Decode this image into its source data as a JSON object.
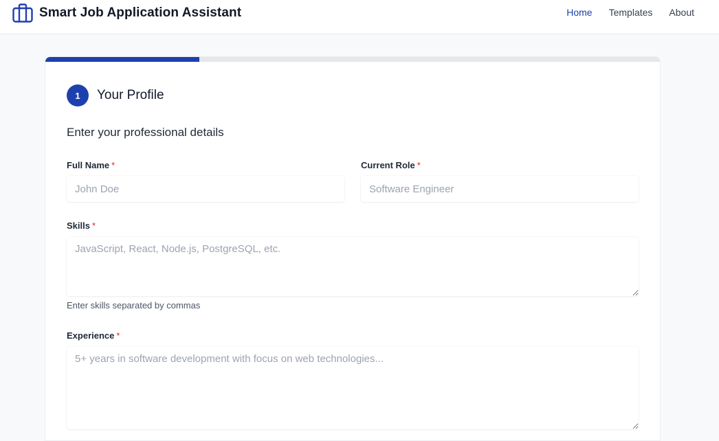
{
  "app": {
    "title": "Smart Job Application Assistant",
    "icon": "briefcase-icon",
    "accent": "#1e40af"
  },
  "nav": {
    "items": [
      {
        "label": "Home",
        "active": true
      },
      {
        "label": "Templates",
        "active": false
      },
      {
        "label": "About",
        "active": false
      }
    ]
  },
  "wizard": {
    "progress_fraction": 0.25,
    "step_number": "1",
    "step_title": "Your Profile",
    "section_title": "Enter your professional details"
  },
  "form": {
    "required_marker": "*",
    "full_name": {
      "label": "Full Name",
      "placeholder": "John Doe",
      "value": ""
    },
    "current_role": {
      "label": "Current Role",
      "placeholder": "Software Engineer",
      "value": ""
    },
    "skills": {
      "label": "Skills",
      "placeholder": "JavaScript, React, Node.js, PostgreSQL, etc.",
      "hint": "Enter skills separated by commas",
      "value": ""
    },
    "experience": {
      "label": "Experience",
      "placeholder": "5+ years in software development with focus on web technologies...",
      "value": ""
    }
  }
}
